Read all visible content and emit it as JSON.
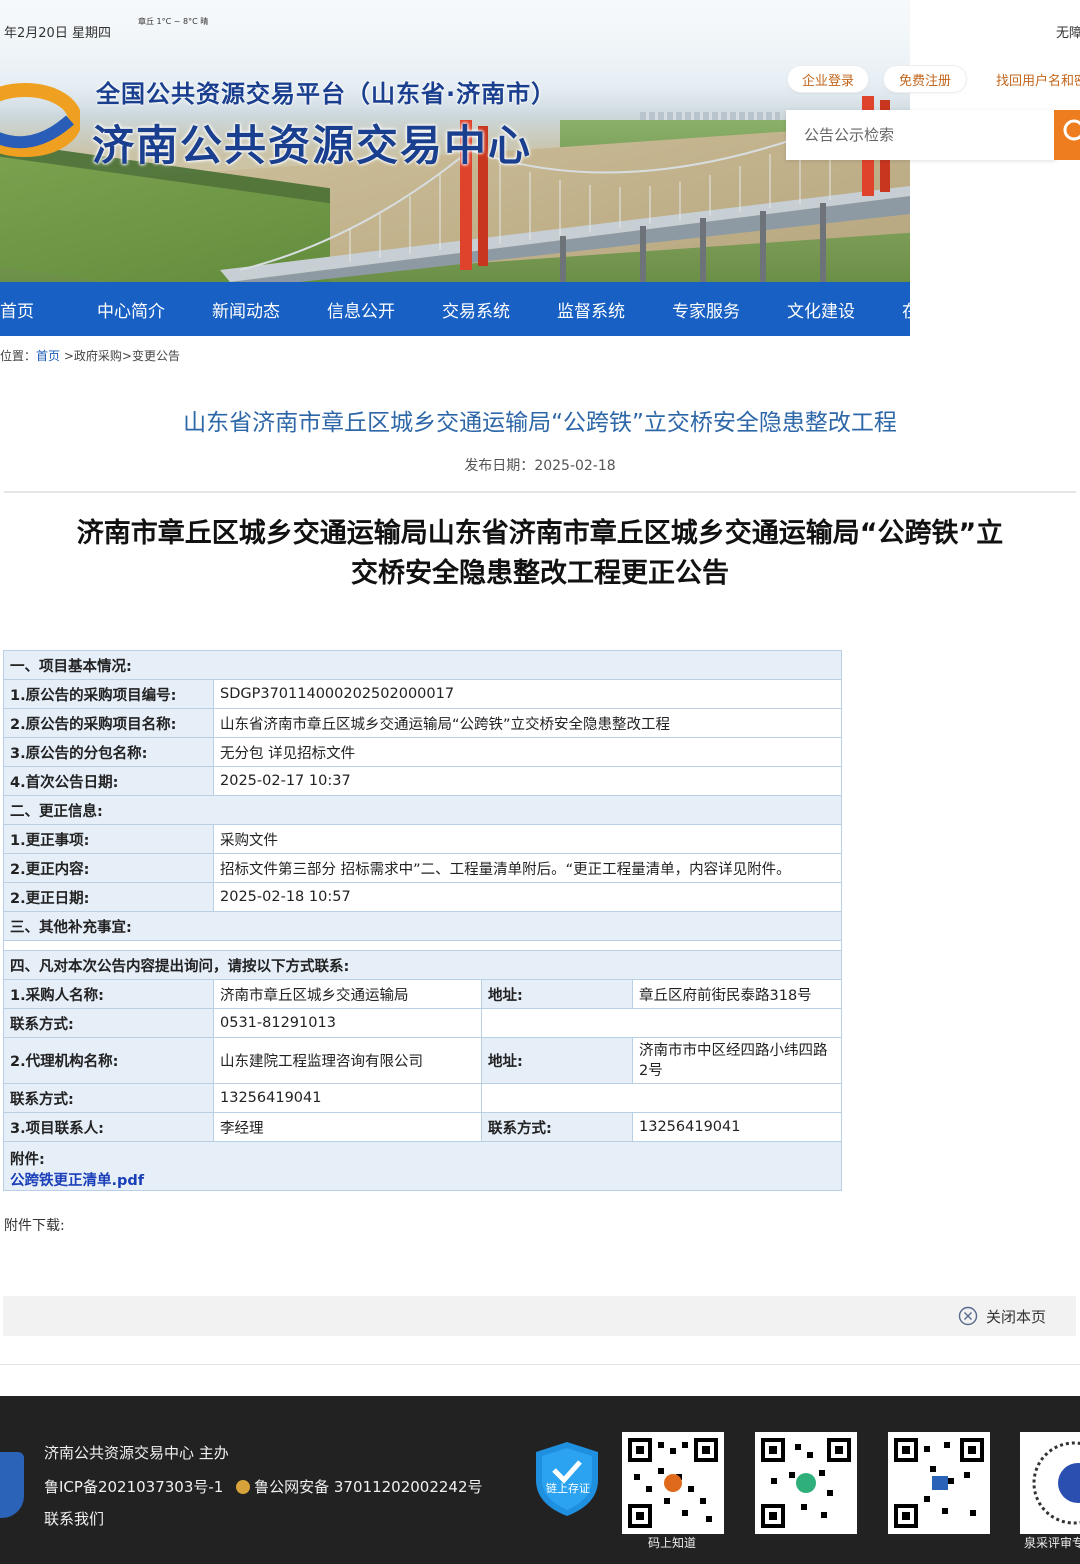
{
  "header": {
    "date": "年2月20日 星期四",
    "weather": "章丘 1°C ~ 8°C 晴",
    "sub_title": "全国公共资源交易平台（山东省·济南市）",
    "main_title": "济南公共资源交易中心",
    "accessibility": "无障",
    "login_label": "企业登录",
    "register_label": "免费注册",
    "retrieve_label": "找回用户名和密",
    "search_placeholder": "公告公示检索"
  },
  "nav": {
    "items": [
      "首页",
      "中心简介",
      "新闻动态",
      "信息公开",
      "交易系统",
      "监督系统",
      "专家服务",
      "文化建设",
      "在"
    ]
  },
  "breadcrumb": {
    "prefix": "位置：",
    "home": "首页",
    "rest": " >政府采购>变更公告"
  },
  "article": {
    "title": "山东省济南市章丘区城乡交通运输局“公跨铁”立交桥安全隐患整改工程",
    "date_label": "发布日期：",
    "date": "2025-02-18",
    "doc_title_line1": "济南市章丘区城乡交通运输局山东省济南市章丘区城乡交通运输局“公跨铁”立",
    "doc_title_line2": "交桥安全隐患整改工程更正公告"
  },
  "table": {
    "sec1": "一、项目基本情况:",
    "r1_label": "1.原公告的采购项目编号:",
    "r1_value": "SDGP370114000202502000017",
    "r2_label": "2.原公告的采购项目名称:",
    "r2_value": "山东省济南市章丘区城乡交通运输局“公跨铁”立交桥安全隐患整改工程",
    "r3_label": "3.原公告的分包名称:",
    "r3_value": "无分包 详见招标文件",
    "r4_label": "4.首次公告日期:",
    "r4_value": "2025-02-17 10:37",
    "sec2": "二、更正信息:",
    "r5_label": "1.更正事项:",
    "r5_value": "采购文件",
    "r6_label": "2.更正内容:",
    "r6_value": "招标文件第三部分 招标需求中”二、工程量清单附后。“更正工程量清单，内容详见附件。",
    "r7_label": "2.更正日期:",
    "r7_value": "2025-02-18 10:57",
    "sec3": "三、其他补充事宜:",
    "sec4": "四、凡对本次公告内容提出询问，请按以下方式联系:",
    "buyer_label": "1.采购人名称:",
    "buyer_value": "济南市章丘区城乡交通运输局",
    "buyer_addr_label": "地址:",
    "buyer_addr_value": "章丘区府前街民泰路318号",
    "buyer_contact_label": "联系方式:",
    "buyer_contact_value": "0531-81291013",
    "agent_label": "2.代理机构名称:",
    "agent_value": "山东建院工程监理咨询有限公司",
    "agent_addr_label": "地址:",
    "agent_addr_value": "济南市市中区经四路小纬四路2号",
    "agent_contact_label": "联系方式:",
    "agent_contact_value": "13256419041",
    "pm_label": "3.项目联系人:",
    "pm_value": "李经理",
    "pm_contact_label": "联系方式:",
    "pm_contact_value": "13256419041",
    "attach_label": "附件:",
    "attach_file": "公跨铁更正清单.pdf"
  },
  "attachments_download_label": "附件下载:",
  "close_label": "关闭本页",
  "footer": {
    "host": "济南公共资源交易中心 主办",
    "icp": "鲁ICP备2021037303号-1",
    "police": "鲁公网安备 37011202002242号",
    "contact": "联系我们",
    "shield_text": "链上存证",
    "qr1_caption": "码上知道",
    "qr4_caption": "泉采评审专"
  },
  "colors": {
    "nav_bg": "#1860c3",
    "accent_orange": "#ee7d1f",
    "title_blue": "#2e67a8",
    "table_header_bg": "#e6eef8",
    "footer_bg": "#222222"
  }
}
